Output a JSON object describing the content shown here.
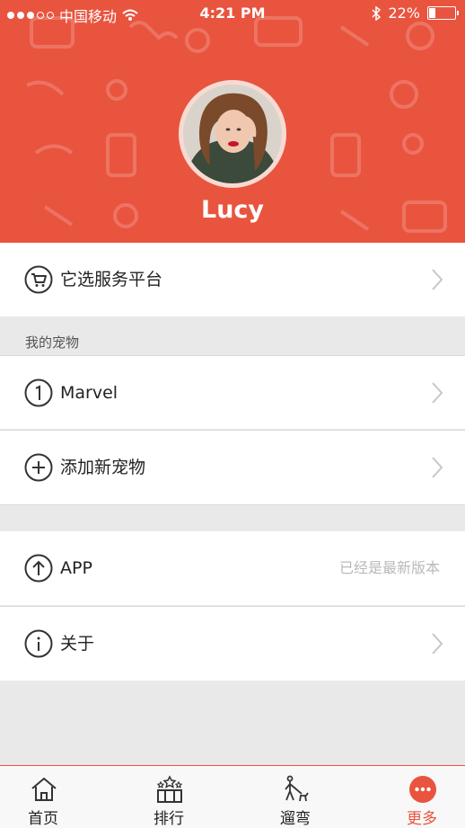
{
  "status_bar": {
    "carrier": "中国移动",
    "time": "4:21 PM",
    "battery_percent": "22%"
  },
  "profile": {
    "name": "Lucy"
  },
  "menu": {
    "platform_label": "它选服务平台",
    "my_pets_title": "我的宠物",
    "pet_item_label": "Marvel",
    "add_pet_label": "添加新宠物",
    "app_label": "APP",
    "app_note": "已经是最新版本",
    "about_label": "关于"
  },
  "tabbar": {
    "home": "首页",
    "ranking": "排行",
    "walk": "遛弯",
    "more": "更多"
  },
  "colors": {
    "accent": "#e9543f"
  }
}
